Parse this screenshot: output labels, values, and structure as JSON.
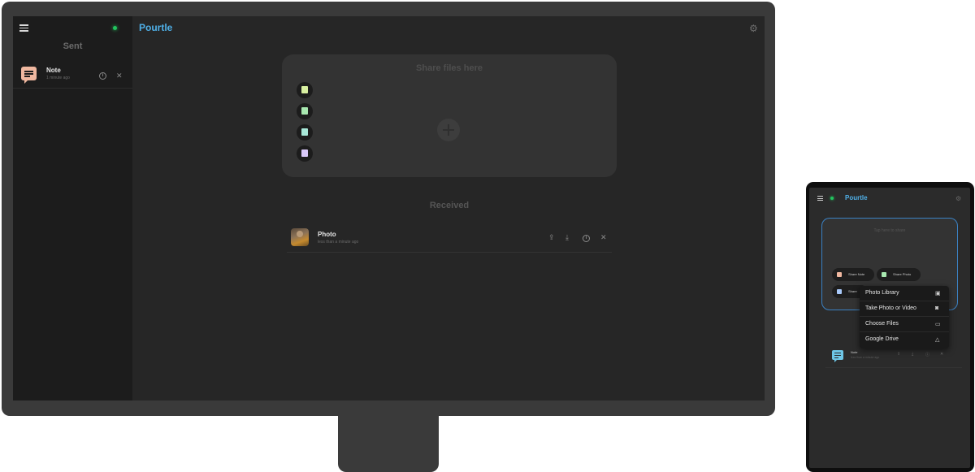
{
  "desktop": {
    "app_name": "Pourtle",
    "sidebar": {
      "title": "Sent",
      "items": [
        {
          "name": "Note",
          "time": "1 minute ago",
          "icon": "note-icon"
        }
      ]
    },
    "share_panel": {
      "title": "Share files here",
      "buttons": [
        {
          "icon": "note-icon",
          "color": "#d8f0a0"
        },
        {
          "icon": "photo-icon",
          "color": "#a8e8b0"
        },
        {
          "icon": "file-icon",
          "color": "#a8e8d8"
        },
        {
          "icon": "clipboard-icon",
          "color": "#d8c8f8"
        }
      ]
    },
    "received": {
      "title": "Received",
      "items": [
        {
          "name": "Photo",
          "time": "less than a minute ago",
          "icon": "photo-thumbnail"
        }
      ]
    },
    "status_color": "#22c55e",
    "brand_color": "#4fb0e8"
  },
  "tablet": {
    "app_name": "Pourtle",
    "share_panel": {
      "title": "Tap here to share",
      "buttons": [
        {
          "label": "Share Note",
          "icon": "note-icon",
          "color": "#f0b8a0"
        },
        {
          "label": "Share Photo",
          "icon": "photo-icon",
          "color": "#a8e8b0"
        },
        {
          "label": "Share",
          "icon": "file-icon",
          "color": "#a8c8f8"
        }
      ]
    },
    "menu": [
      {
        "label": "Photo Library",
        "icon": "photo-library-icon"
      },
      {
        "label": "Take Photo or Video",
        "icon": "camera-icon"
      },
      {
        "label": "Choose Files",
        "icon": "folder-icon"
      },
      {
        "label": "Google Drive",
        "icon": "google-drive-icon"
      }
    ],
    "received": {
      "items": [
        {
          "name": "Note",
          "time": "less than a minute ago",
          "icon": "note-icon"
        }
      ]
    }
  }
}
